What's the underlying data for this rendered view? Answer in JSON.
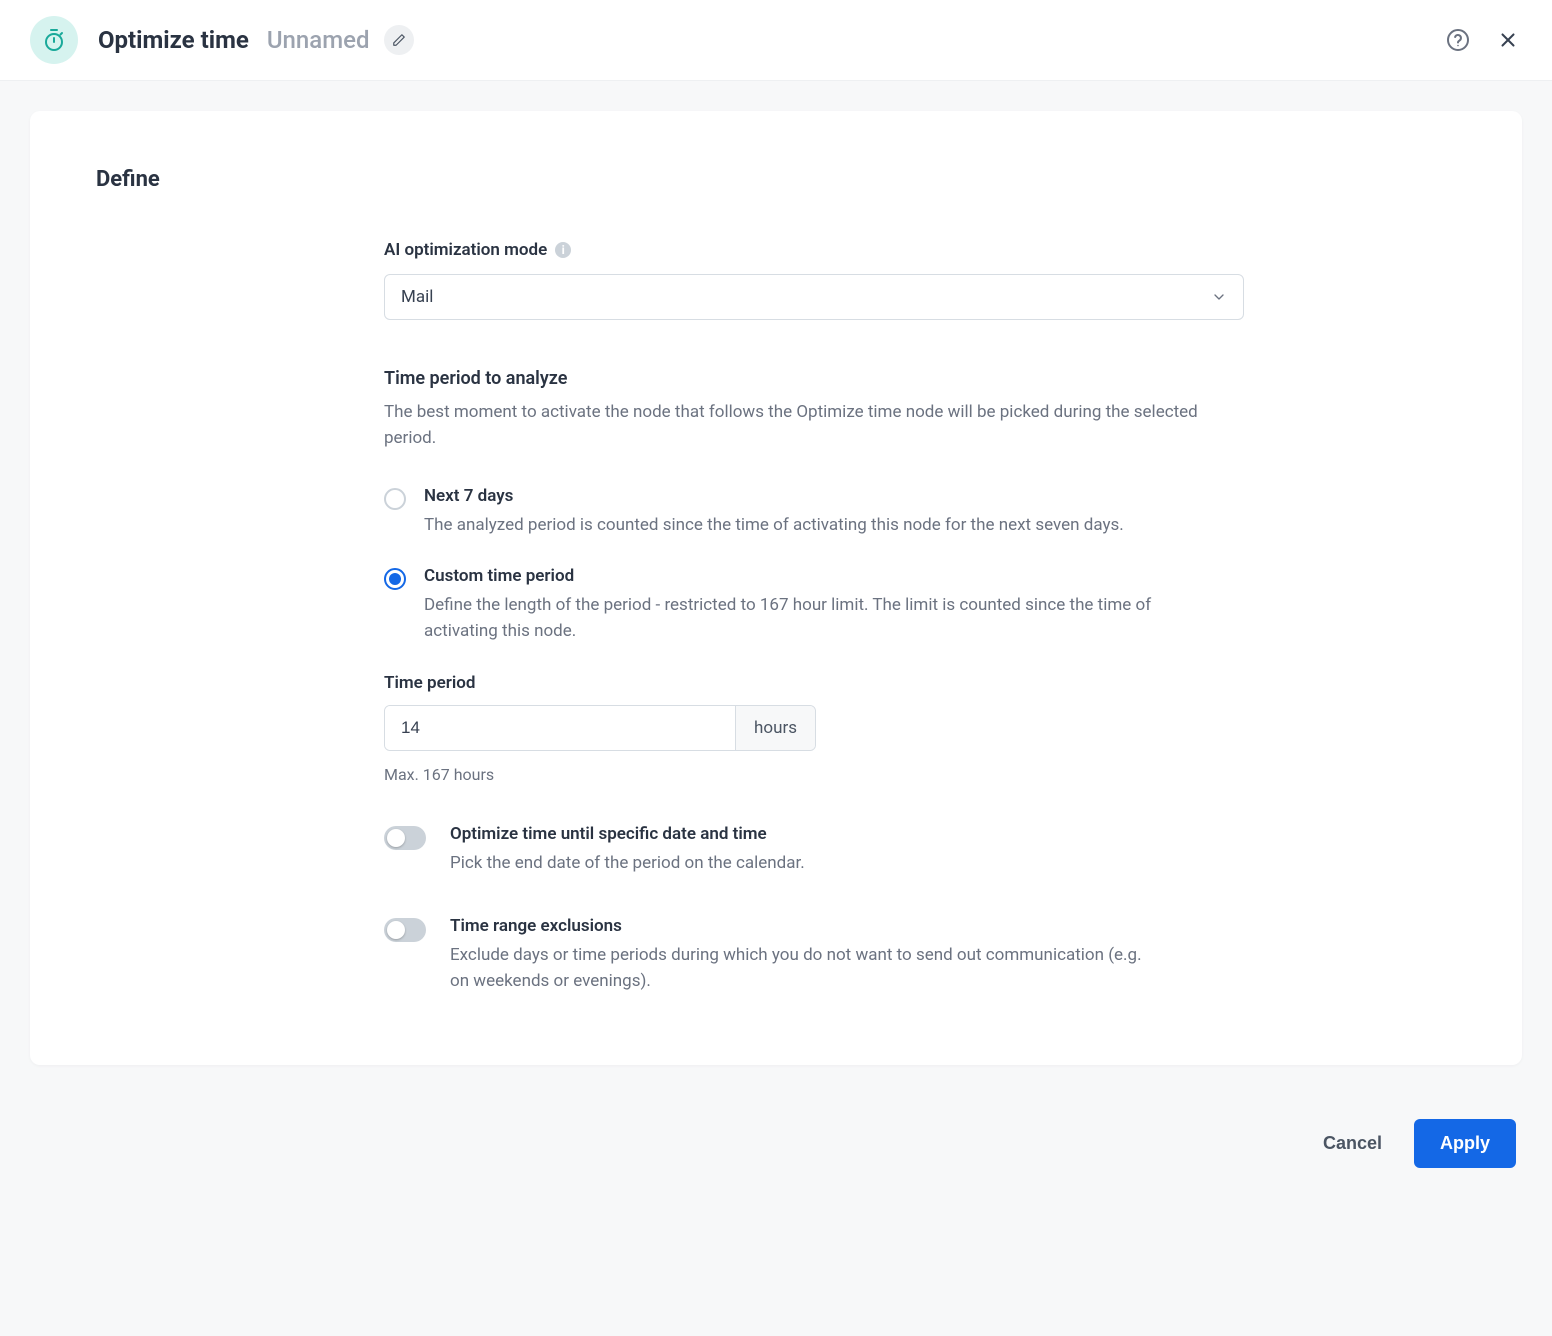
{
  "header": {
    "title": "Optimize time",
    "subtitle": "Unnamed"
  },
  "section": {
    "title": "Define"
  },
  "mode": {
    "label": "AI optimization mode",
    "value": "Mail"
  },
  "period_group": {
    "label": "Time period to analyze",
    "desc": "The best moment to activate the node that follows the Optimize time node will be picked during the selected period."
  },
  "radios": {
    "next7": {
      "title": "Next 7 days",
      "desc": "The analyzed period is counted since the time of activating this node for the next seven days."
    },
    "custom": {
      "title": "Custom time period",
      "desc": "Define the length of the period - restricted to 167 hour limit. The limit is counted since the time of activating this node."
    }
  },
  "time_period": {
    "label": "Time period",
    "value": "14",
    "unit": "hours",
    "hint": "Max. 167 hours"
  },
  "toggles": {
    "until_date": {
      "title": "Optimize time until specific date and time",
      "desc": "Pick the end date of the period on the calendar."
    },
    "exclusions": {
      "title": "Time range exclusions",
      "desc": "Exclude days or time periods during which you do not want to send out communication (e.g. on weekends or evenings)."
    }
  },
  "footer": {
    "cancel": "Cancel",
    "apply": "Apply"
  }
}
